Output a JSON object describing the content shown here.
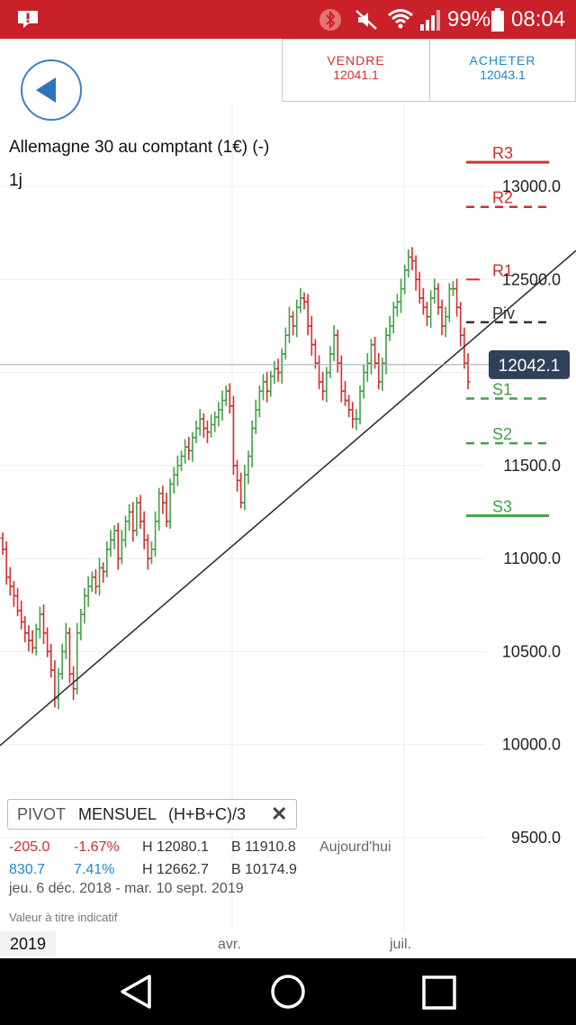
{
  "status_bar": {
    "alert_icon": "alert-icon",
    "battery": "99%",
    "time": "08:04"
  },
  "trade": {
    "sell_label": "VENDRE",
    "sell_price": "12041.1",
    "buy_label": "ACHETER",
    "buy_price": "12043.1"
  },
  "instrument": {
    "name": "Allemagne 30 au comptant (1€) (-)",
    "timeframe": "1j"
  },
  "chart_data": {
    "type": "ohlc",
    "y_range": [
      9400,
      13400
    ],
    "y_ticks": [
      "13000.0",
      "12500.0",
      "12000.0",
      "11500.0",
      "11000.0",
      "10500.0",
      "10000.0",
      "9500.0"
    ],
    "y_tick_values": [
      13000,
      12500,
      12000,
      11500,
      11000,
      10500,
      10000,
      9500
    ],
    "x_labels": [
      "2019",
      "avr.",
      "juil."
    ],
    "current_price": "12042.1",
    "current_price_value": 12042.1,
    "pivot_levels": [
      {
        "name": "R3",
        "value": 13130,
        "color": "#d32f2f",
        "style": "solid"
      },
      {
        "name": "R2",
        "value": 12890,
        "color": "#d32f2f",
        "style": "dashed"
      },
      {
        "name": "R1",
        "value": 12500,
        "color": "#d32f2f",
        "style": "short"
      },
      {
        "name": "Piv",
        "value": 12270,
        "color": "#333333",
        "style": "dashed"
      },
      {
        "name": "S1",
        "value": 11860,
        "color": "#43a047",
        "style": "dashed"
      },
      {
        "name": "S2",
        "value": 11620,
        "color": "#43a047",
        "style": "dashed"
      },
      {
        "name": "S3",
        "value": 11230,
        "color": "#43a047",
        "style": "solid"
      }
    ],
    "trendline": {
      "from_value": 9995,
      "to_value": 12655
    },
    "closes": [
      11050,
      10900,
      10850,
      10800,
      10720,
      10660,
      10600,
      10560,
      10520,
      10620,
      10700,
      10600,
      10500,
      10400,
      10250,
      10380,
      10500,
      10600,
      10380,
      10300,
      10600,
      10700,
      10800,
      10850,
      10900,
      10850,
      10950,
      10930,
      11050,
      11100,
      11150,
      11000,
      11100,
      11200,
      11250,
      11150,
      11300,
      11200,
      11100,
      11000,
      11050,
      11200,
      11350,
      11300,
      11200,
      11400,
      11450,
      11500,
      11550,
      11600,
      11580,
      11650,
      11700,
      11750,
      11700,
      11680,
      11720,
      11760,
      11800,
      11850,
      11900,
      11820,
      11500,
      11420,
      11300,
      11450,
      11550,
      11700,
      11800,
      11900,
      11950,
      11900,
      11980,
      12020,
      12000,
      12100,
      12200,
      12300,
      12250,
      12350,
      12400,
      12380,
      12250,
      12150,
      12050,
      11950,
      11900,
      12000,
      12100,
      12200,
      12050,
      11900,
      11850,
      11800,
      11750,
      11750,
      11900,
      12000,
      12050,
      12150,
      12050,
      11950,
      12050,
      12200,
      12250,
      12350,
      12380,
      12450,
      12550,
      12620,
      12600,
      12500,
      12400,
      12350,
      12300,
      12400,
      12450,
      12350,
      12250,
      12300,
      12450,
      12450,
      12350,
      12200,
      12050,
      11950
    ]
  },
  "indicator": {
    "name": "PIVOT",
    "period": "MENSUEL",
    "formula": "(H+B+C)/3"
  },
  "stats": {
    "row1": {
      "change": "-205.0",
      "pct": "-1.67%",
      "high": "H 12080.1",
      "low": "B 11910.8",
      "label": "Aujourd'hui"
    },
    "row2": {
      "change": "830.7",
      "pct": "7.41%",
      "high": "H 12662.7",
      "low": "B 10174.9"
    },
    "date_range": "jeu. 6 déc. 2018 - mar. 10 sept. 2019",
    "disclaimer": "Valeur à titre indicatif"
  }
}
